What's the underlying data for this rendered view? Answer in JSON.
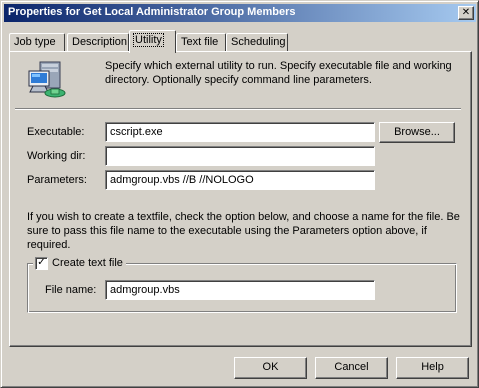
{
  "window": {
    "title": "Properties for Get Local Administrator Group Members",
    "close_glyph": "✕"
  },
  "tabs": [
    {
      "label": "Job type",
      "active": false
    },
    {
      "label": "Description",
      "active": false
    },
    {
      "label": "Utility",
      "active": true
    },
    {
      "label": "Text file",
      "active": false
    },
    {
      "label": "Scheduling",
      "active": false
    }
  ],
  "utility": {
    "icon": "computer-icon",
    "description": "Specify which external utility to run. Specify executable file and working directory. Optionally specify command line parameters.",
    "executable_label": "Executable:",
    "executable_value": "cscript.exe",
    "browse_label": "Browse...",
    "working_dir_label": "Working dir:",
    "working_dir_value": "",
    "parameters_label": "Parameters:",
    "parameters_value": "admgroup.vbs //B //NOLOGO",
    "textfile_info": "If you wish to create a textfile, check the option below, and choose a name for the file. Be sure to pass this file name to the executable using the Parameters option above, if required.",
    "create_text_file_label": "Create text file",
    "create_text_file_checked": true,
    "check_glyph": "✓",
    "file_name_label": "File name:",
    "file_name_value": "admgroup.vbs"
  },
  "buttons": {
    "ok": "OK",
    "cancel": "Cancel",
    "help": "Help"
  }
}
